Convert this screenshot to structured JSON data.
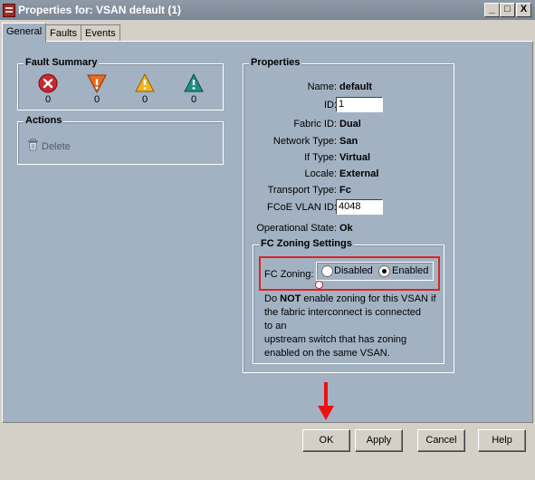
{
  "window": {
    "title": "Properties for: VSAN default (1)",
    "minimize": "_",
    "maximize": "□",
    "close": "X"
  },
  "tabs": [
    {
      "label": "General"
    },
    {
      "label": "Faults"
    },
    {
      "label": "Events"
    }
  ],
  "fault_summary": {
    "title": "Fault Summary",
    "items": [
      {
        "icon": "critical-icon",
        "count": "0"
      },
      {
        "icon": "major-icon",
        "count": "0"
      },
      {
        "icon": "minor-icon",
        "count": "0"
      },
      {
        "icon": "warning-icon",
        "count": "0"
      }
    ]
  },
  "actions": {
    "title": "Actions",
    "delete_label": "Delete"
  },
  "properties": {
    "title": "Properties",
    "name_label": "Name:",
    "name": "default",
    "id_label": "ID:",
    "id": "1",
    "fabric_id_label": "Fabric ID:",
    "fabric_id": "Dual",
    "network_type_label": "Network Type:",
    "network_type": "San",
    "if_type_label": "If Type:",
    "if_type": "Virtual",
    "locale_label": "Locale:",
    "locale": "External",
    "transport_type_label": "Transport Type:",
    "transport_type": "Fc",
    "fcoe_vlan_id_label": "FCoE VLAN ID:",
    "fcoe_vlan_id": "4048",
    "operational_state_label": "Operational State:",
    "operational_state": "Ok"
  },
  "fc_zoning": {
    "title": "FC Zoning Settings",
    "label": "FC Zoning:",
    "option_disabled": "Disabled",
    "option_enabled": "Enabled",
    "selected": "Enabled",
    "note_prefix": "Do ",
    "note_bold": "NOT",
    "note_line1_rest": " enable zoning for this VSAN if",
    "note_line2": "the fabric interconnect is connected",
    "note_line3": "to an",
    "note_line4": "upstream switch that has zoning",
    "note_line5": "enabled on the same VSAN."
  },
  "buttons": {
    "ok": "OK",
    "apply": "Apply",
    "cancel": "Cancel",
    "help": "Help"
  },
  "colors": {
    "panel": "#a3b2c3",
    "highlight": "#dd2222",
    "arrow": "#ee1111"
  }
}
